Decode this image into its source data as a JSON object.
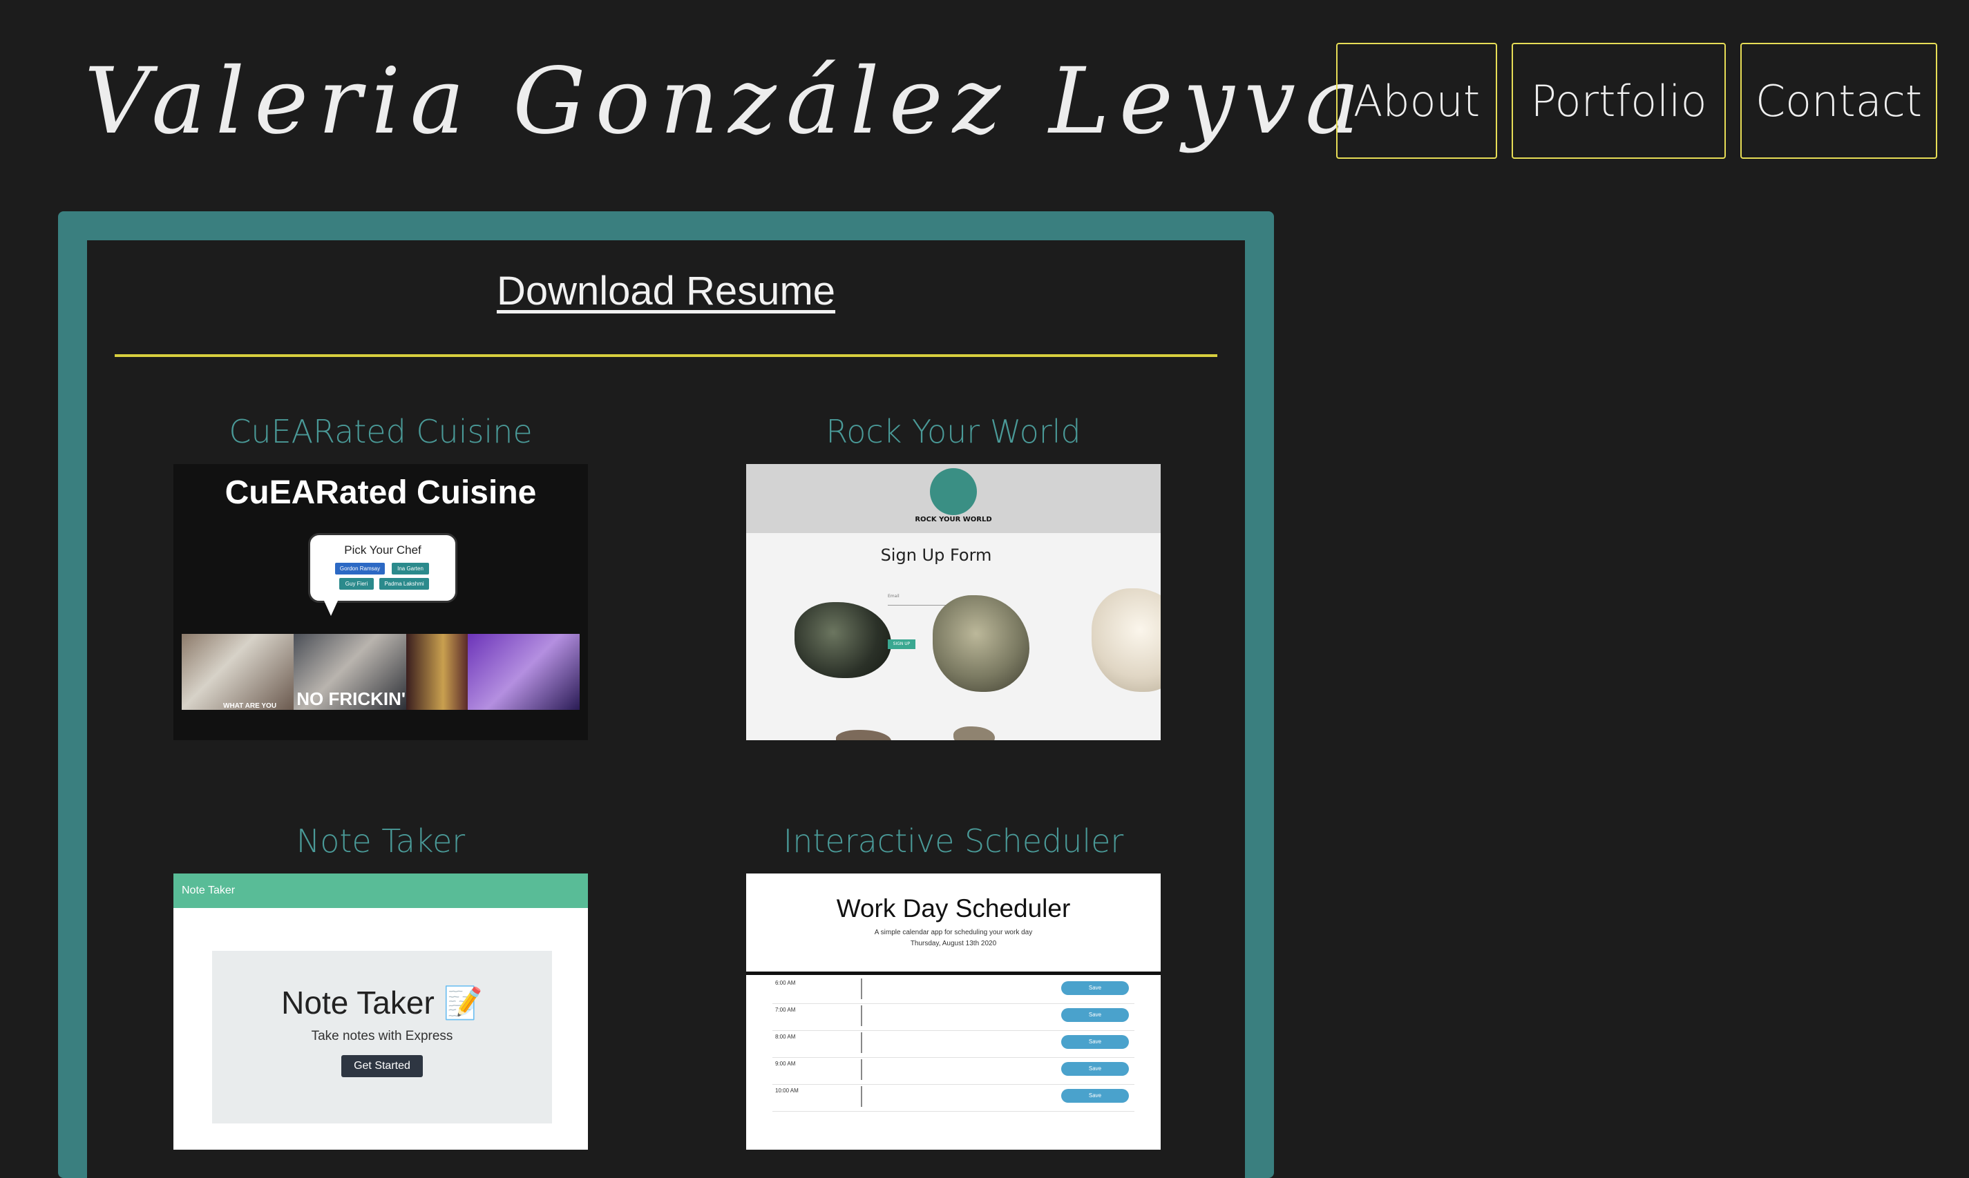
{
  "header": {
    "site_title": "Valeria González Leyva"
  },
  "nav": {
    "about": "About",
    "portfolio": "Portfolio",
    "contact": "Contact"
  },
  "resume": {
    "link_text": "Download  Resume"
  },
  "colors": {
    "accent_yellow": "#e7dd56",
    "teal_panel": "#3a7f7f",
    "title_teal": "#4a9a98",
    "background": "#1c1c1c"
  },
  "projects": [
    {
      "title": "CuEARated Cuisine",
      "screenshot": {
        "heading": "CuEARated Cuisine",
        "bubble_title": "Pick Your Chef",
        "chips": [
          "Gordon Ramsay",
          "Ina Garten",
          "Guy Fieri",
          "Padma Lakshmi"
        ],
        "captions": [
          "WHAT ARE YOU",
          "NO FRICKIN'"
        ]
      }
    },
    {
      "title": "Rock Your World",
      "screenshot": {
        "logo_text": "ROCK YOUR WORLD",
        "form_title": "Sign Up Form",
        "field_label": "Email",
        "button": "SIGN UP"
      }
    },
    {
      "title": "Note Taker",
      "screenshot": {
        "nav_title": "Note Taker",
        "heading": "Note Taker 📝",
        "subtitle": "Take notes with Express",
        "button": "Get Started"
      }
    },
    {
      "title": "Interactive Scheduler",
      "screenshot": {
        "heading": "Work Day Scheduler",
        "subtitle": "A simple calendar app for scheduling your work day",
        "date": "Thursday, August 13th 2020",
        "times": [
          "6:00 AM",
          "7:00 AM",
          "8:00 AM",
          "9:00 AM",
          "10:00 AM"
        ],
        "save_label": "Save"
      }
    }
  ]
}
